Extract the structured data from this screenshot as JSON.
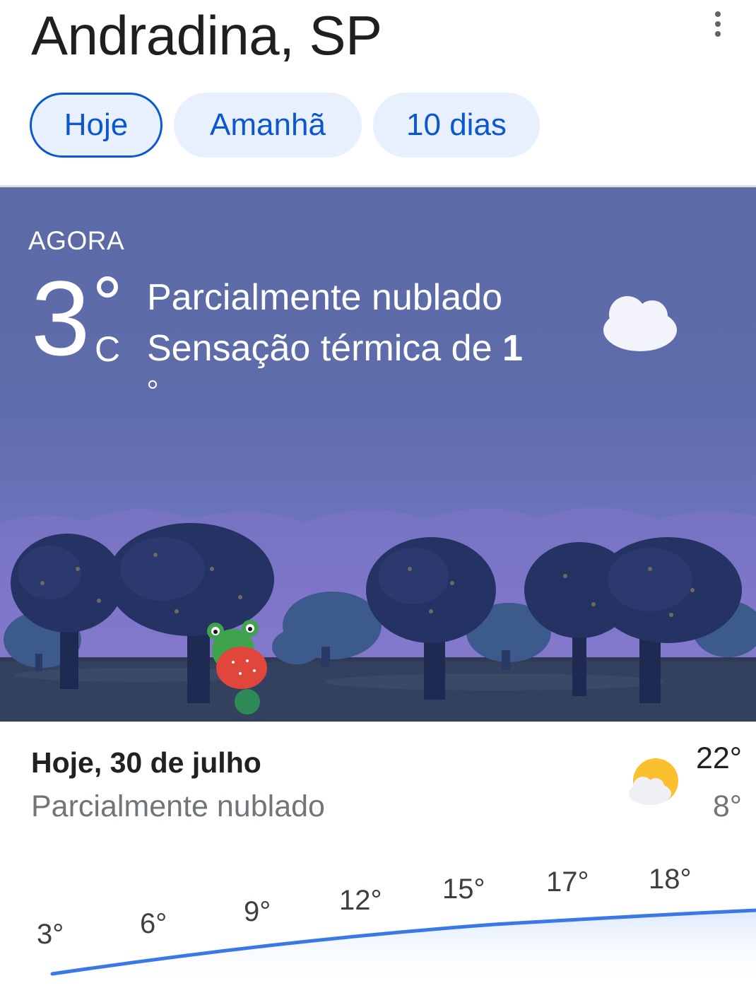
{
  "header": {
    "location": "Andradina, SP",
    "menu_icon": "more-vert-icon"
  },
  "tabs": [
    {
      "label": "Hoje",
      "active": true
    },
    {
      "label": "Amanhã",
      "active": false
    },
    {
      "label": "10 dias",
      "active": false
    }
  ],
  "current": {
    "label": "AGORA",
    "temperature": "3",
    "unit": "C",
    "condition": "Parcialmente nublado",
    "feels_like_prefix": "Sensação térmica de ",
    "feels_like_value": "1",
    "icon": "partly-cloudy-night-icon"
  },
  "today": {
    "title": "Hoje, 30 de julho",
    "condition": "Parcialmente nublado",
    "high": "22°",
    "low": "8°",
    "icon": "partly-cloudy-day-icon"
  },
  "hourly_temps": [
    "3°",
    "6°",
    "9°",
    "12°",
    "15°",
    "17°",
    "18°"
  ],
  "colors": {
    "accent": "#0b57d0",
    "tab_bg": "#e8f0fe",
    "graph_line": "#3b78e7"
  }
}
